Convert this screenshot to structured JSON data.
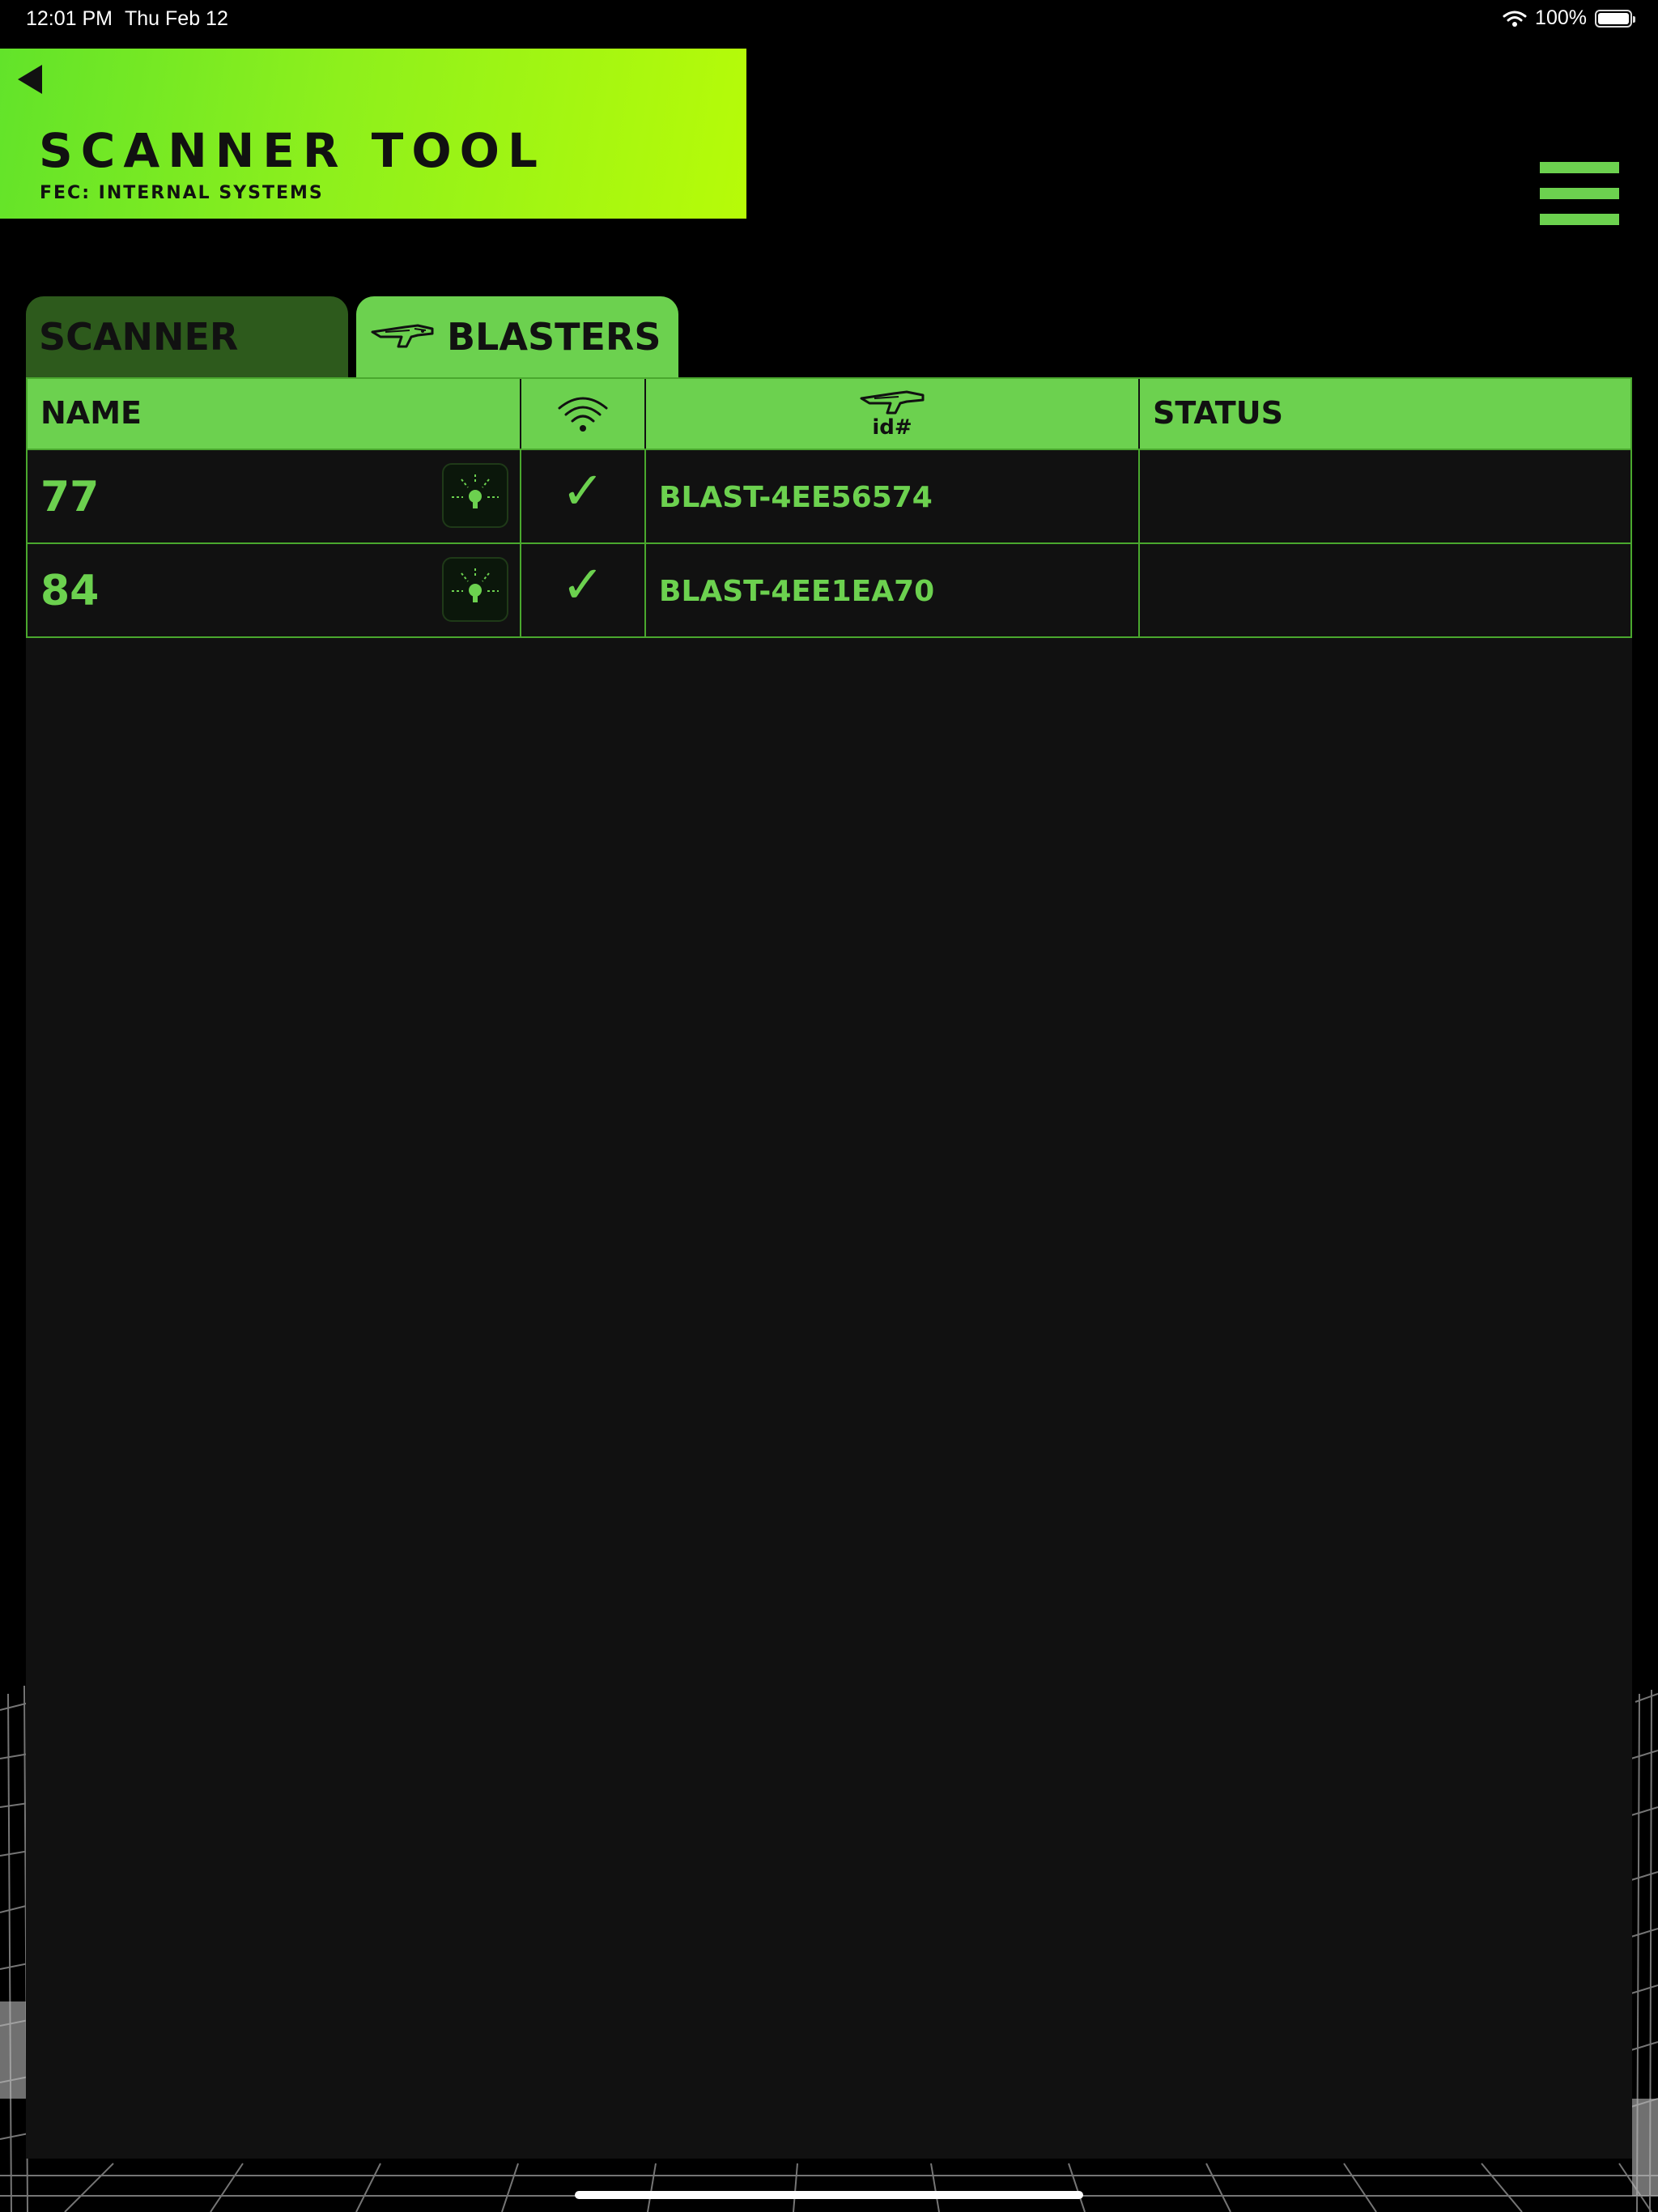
{
  "status_bar": {
    "time": "12:01 PM",
    "date": "Thu Feb 12",
    "battery": "100%",
    "battery_level": 1.0
  },
  "header": {
    "title": "SCANNER TOOL",
    "subtitle": "FEC: INTERNAL SYSTEMS",
    "back_icon": "back-triangle-icon",
    "menu_icon": "hamburger-menu-icon"
  },
  "tabs": [
    {
      "label": "SCANNER",
      "active": false
    },
    {
      "label": "BLASTERS",
      "active": true,
      "icon": "blaster-icon"
    }
  ],
  "table": {
    "columns": {
      "name": "NAME",
      "signal_icon": "wifi-signal-icon",
      "id_icon": "blaster-icon",
      "id_label": "id#",
      "status": "STATUS"
    },
    "rows": [
      {
        "name": "77",
        "light_icon": "lightbulb-icon",
        "connected": "✓",
        "id": "BLAST-4EE56574",
        "status": ""
      },
      {
        "name": "84",
        "light_icon": "lightbulb-icon",
        "connected": "✓",
        "id": "BLAST-4EE1EA70",
        "status": ""
      }
    ]
  },
  "colors": {
    "accent": "#6cd14f",
    "banner_start": "#62e32a",
    "banner_end": "#b7fb08",
    "inactive_tab": "#2d5a1c",
    "panel": "#111111"
  }
}
